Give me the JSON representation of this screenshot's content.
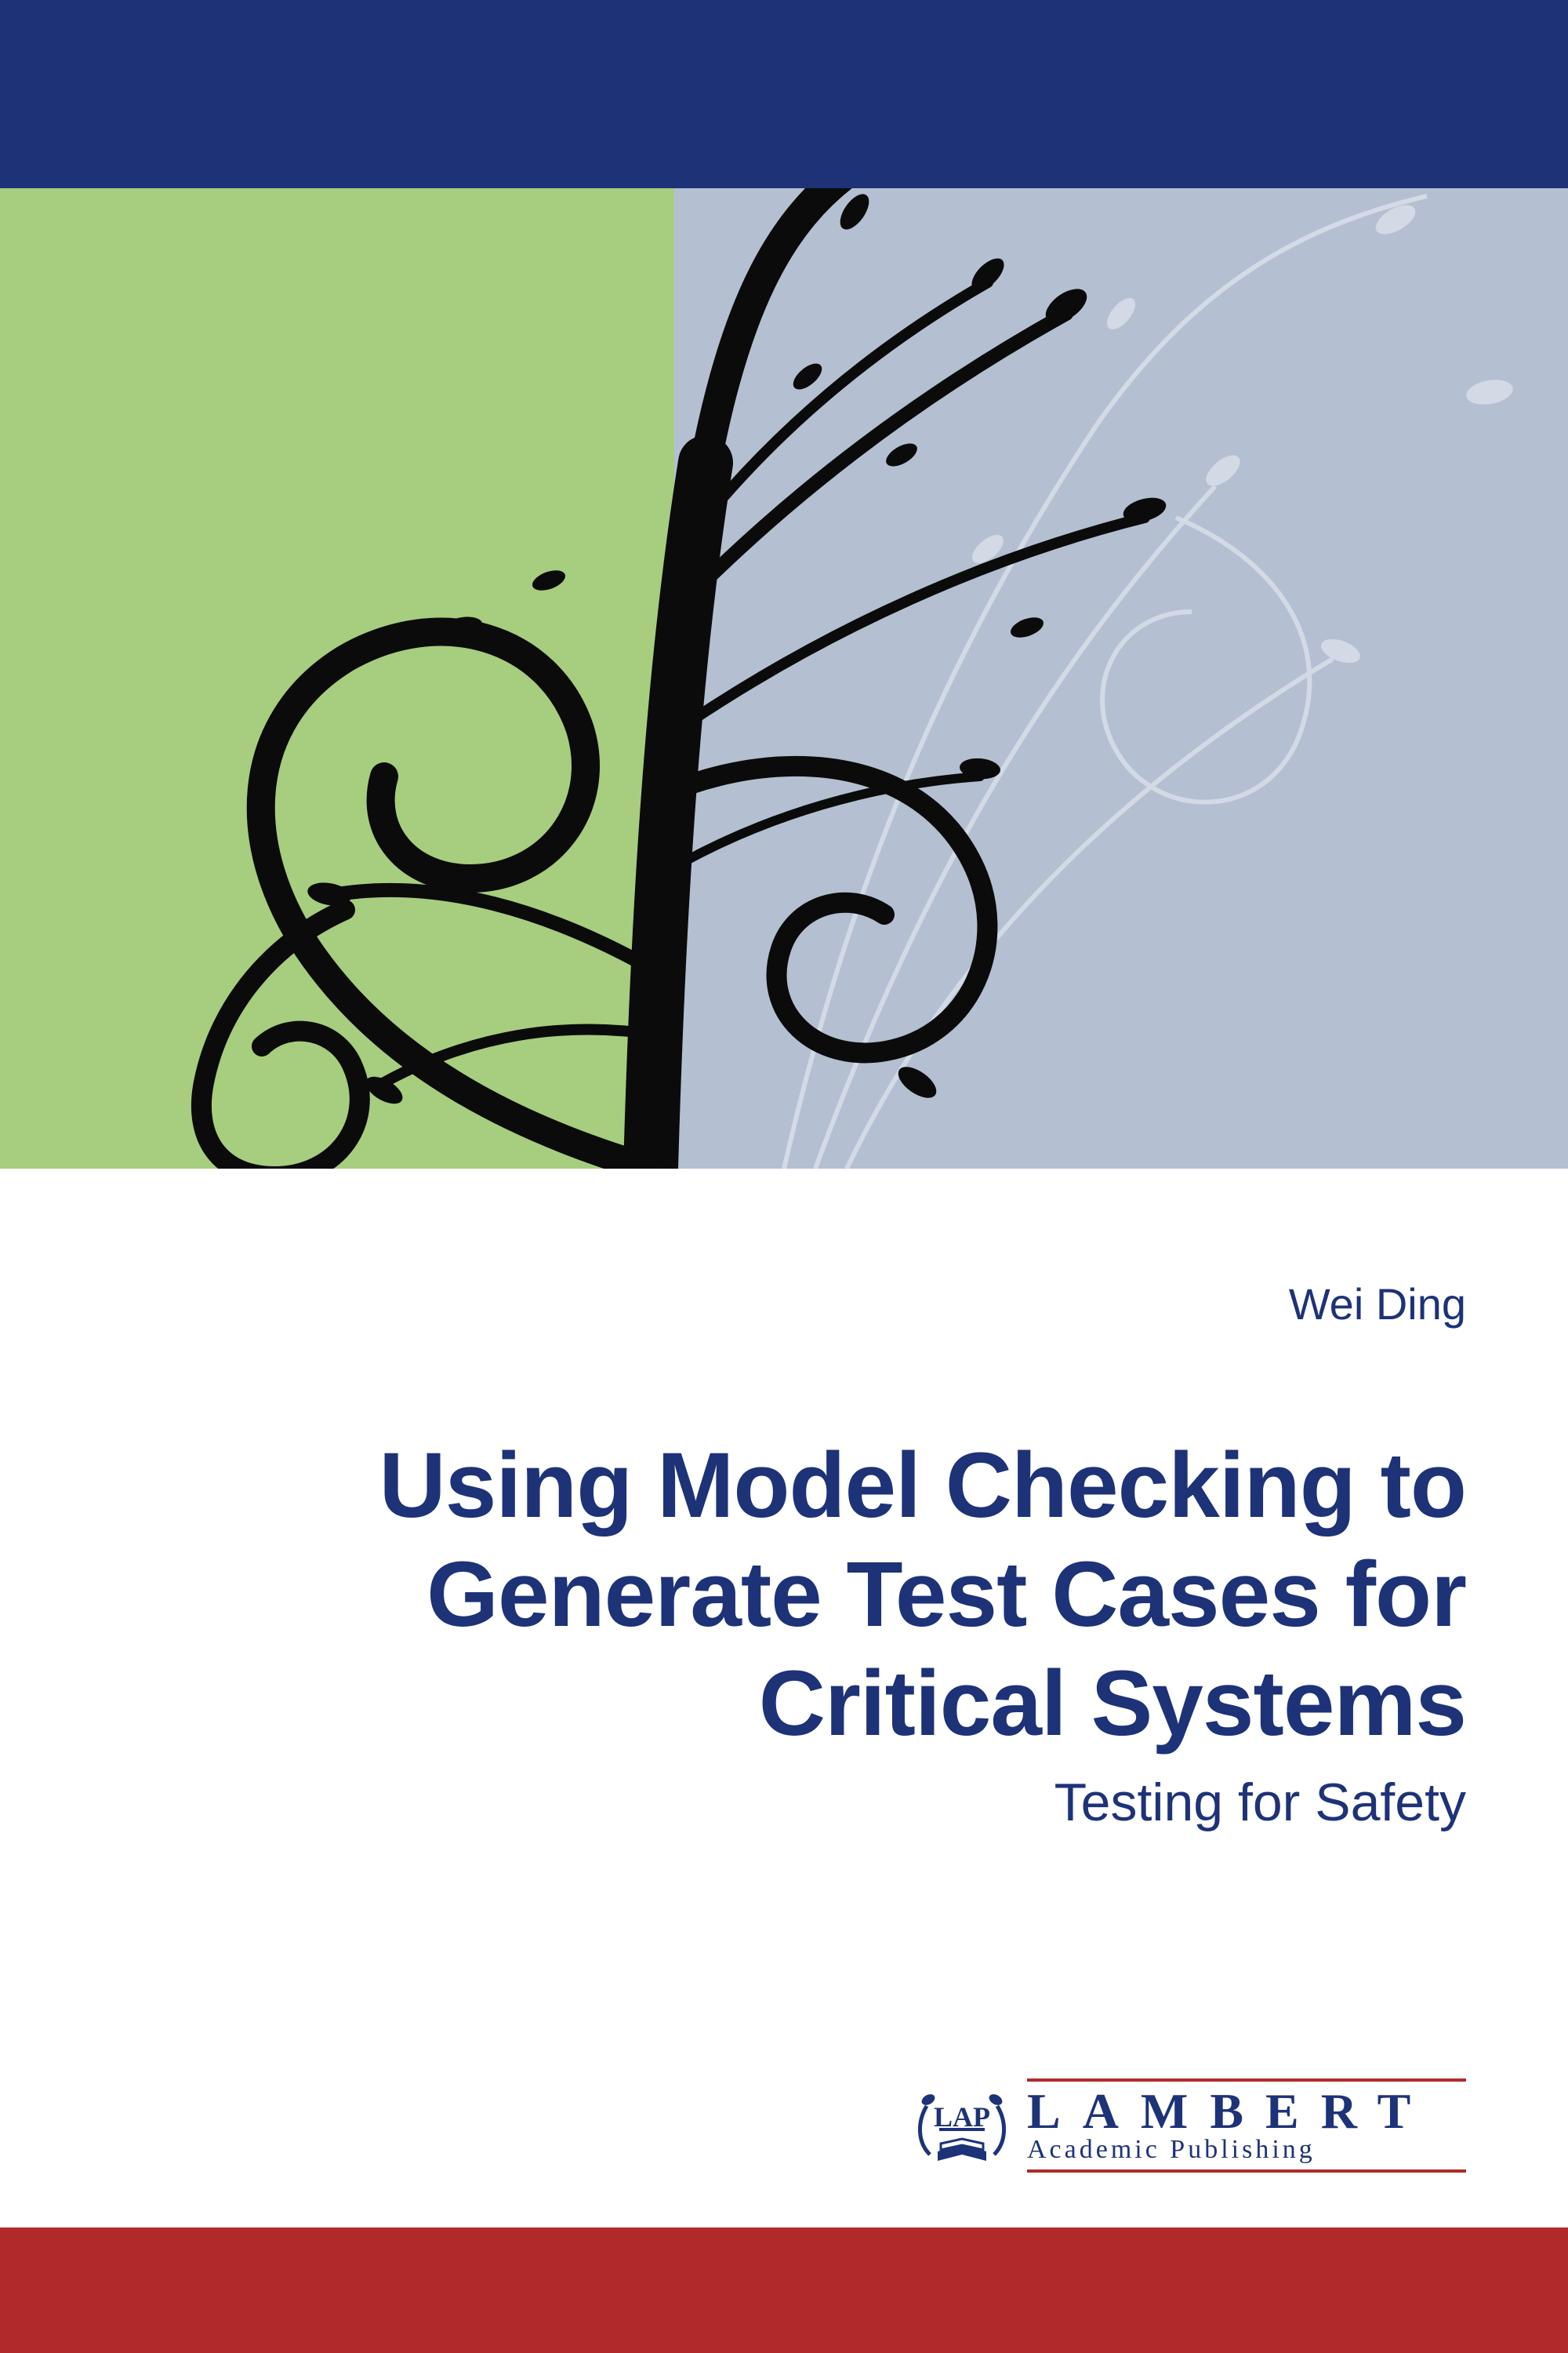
{
  "author": "Wei Ding",
  "title_line1": "Using Model Checking to",
  "title_line2": "Generate Test Cases for",
  "title_line3": "Critical Systems",
  "subtitle": "Testing for Safety",
  "publisher": {
    "badge": "LAP",
    "name": "LAMBERT",
    "sub": "Academic Publishing"
  },
  "colors": {
    "navy": "#1e3278",
    "red": "#b02a2a",
    "green": "#a7cd7f",
    "bluegray": "#b4c0d1"
  }
}
